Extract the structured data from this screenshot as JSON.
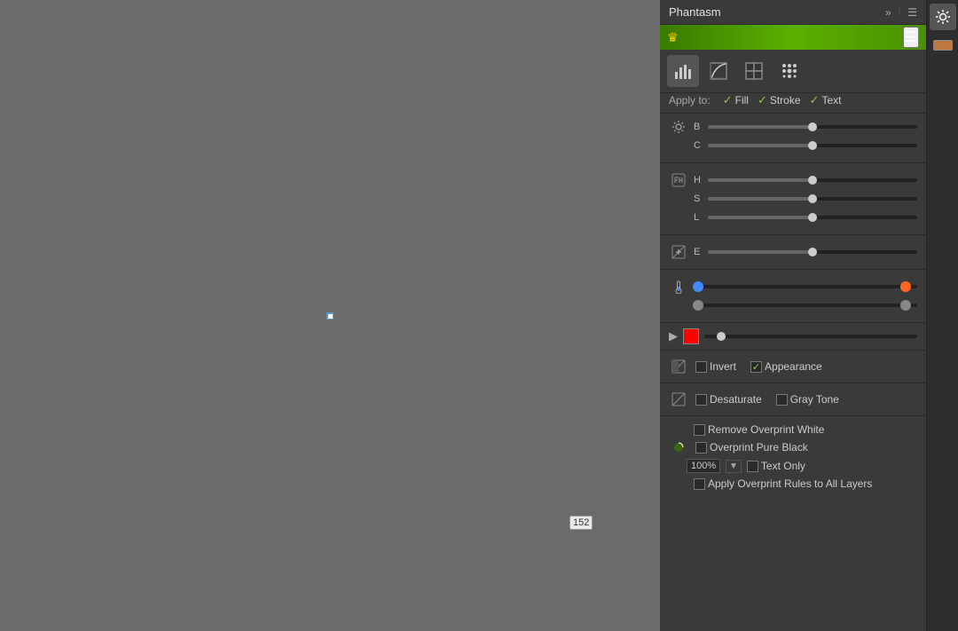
{
  "panel": {
    "title": "Phantasm",
    "expand_icon": "»",
    "menu_icon": "☰",
    "green_banner": {
      "crown": "♛"
    },
    "tools": [
      {
        "id": "histogram",
        "label": "histogram-icon"
      },
      {
        "id": "curves",
        "label": "curves-icon"
      },
      {
        "id": "layers",
        "label": "layers-icon"
      },
      {
        "id": "halftone",
        "label": "halftone-icon"
      }
    ],
    "apply_to": {
      "label": "Apply to:",
      "fill": "Fill",
      "stroke": "Stroke",
      "text": "Text"
    },
    "sliders": {
      "brightness_label": "B",
      "contrast_label": "C",
      "hue_label": "H",
      "saturation_label": "S",
      "lightness_label": "L",
      "exposure_label": "E",
      "brightness_val": 50,
      "contrast_val": 50,
      "hue_val": 50,
      "saturation_val": 50,
      "lightness_val": 50,
      "exposure_val": 50
    },
    "color_sliders": {
      "temp_row1_left": "blue",
      "temp_row1_right": "orange",
      "temp_row2_left": "gray",
      "temp_row2_right": "gray"
    },
    "solid_color": {
      "swatch": "red"
    },
    "checkboxes": {
      "invert_label": "Invert",
      "invert_checked": false,
      "appearance_label": "Appearance",
      "appearance_checked": true,
      "desaturate_label": "Desaturate",
      "desaturate_checked": false,
      "gray_tone_label": "Gray Tone",
      "gray_tone_checked": false,
      "remove_overprint_white_label": "Remove Overprint White",
      "remove_overprint_white_checked": false,
      "overprint_pure_black_label": "Overprint Pure Black",
      "overprint_pure_black_checked": false,
      "apply_overprint_rules_label": "Apply Overprint Rules to All Layers",
      "apply_overprint_rules_checked": false
    },
    "overprint": {
      "percent": "100%",
      "stepper_up": "▲",
      "stepper_down": "▼",
      "text_only_label": "Text Only"
    }
  },
  "side_toolbar": {
    "sun_icon": "☀",
    "paint_icon": "▬"
  },
  "canvas": {
    "cursor_label": "152"
  }
}
